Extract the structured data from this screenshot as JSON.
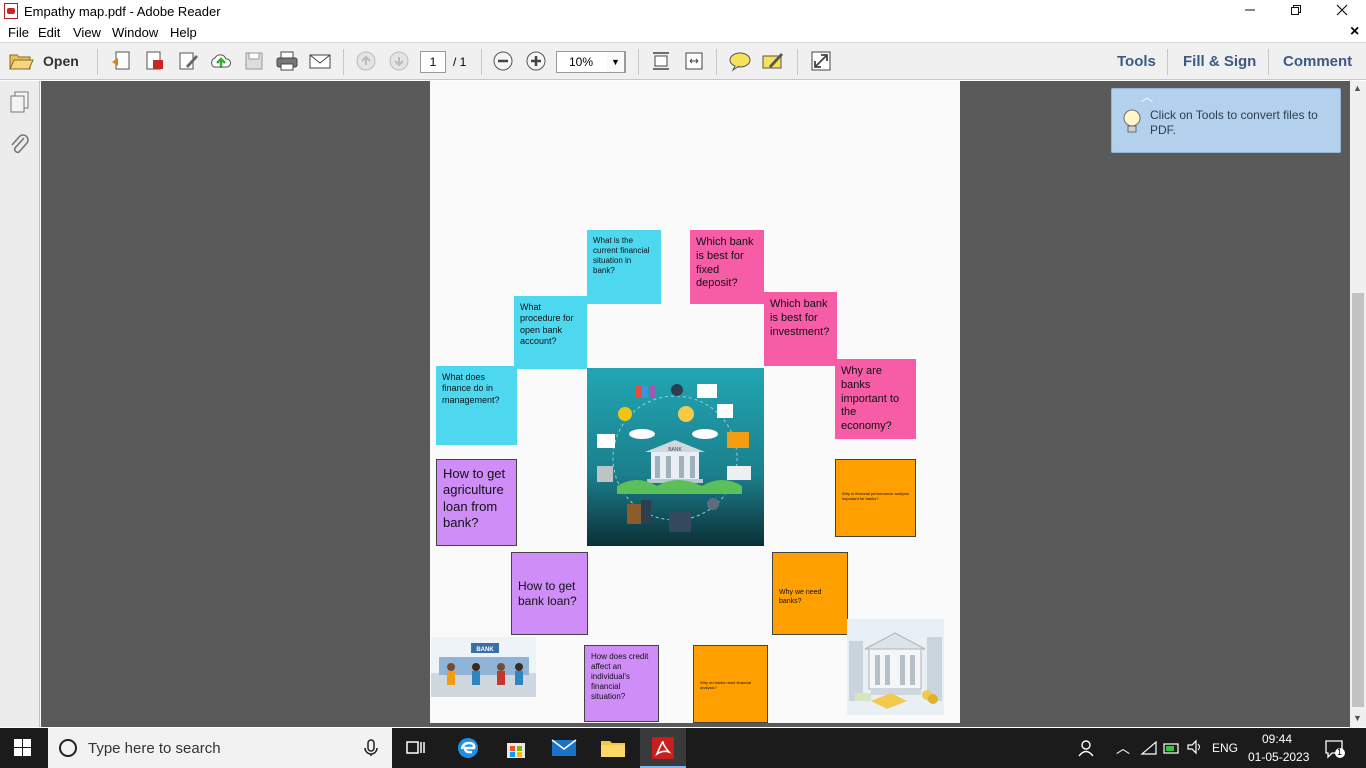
{
  "window": {
    "title": "Empathy map.pdf - Adobe Reader",
    "minimize_icon": "minimize-icon",
    "maximize_icon": "restore-icon",
    "close_icon": "close-icon"
  },
  "menu": {
    "items": [
      "File",
      "Edit",
      "View",
      "Window",
      "Help"
    ],
    "close_doc": "×"
  },
  "toolbar": {
    "open_label": "Open",
    "page_current": "1",
    "page_total": "/ 1",
    "zoom_value": "10%",
    "zoom_dropdown_icon": "chevron-down-icon",
    "tools_label": "Tools",
    "fill_sign_label": "Fill & Sign",
    "comment_label": "Comment"
  },
  "tooltip": {
    "text": "Click on Tools to convert files to PDF."
  },
  "document": {
    "notes": [
      {
        "id": "n1",
        "text": "What is the current financial situation in bank?",
        "color": "#4dd8f0"
      },
      {
        "id": "n2",
        "text": "Which bank is best for fixed deposit?",
        "color": "#f75ca6"
      },
      {
        "id": "n3",
        "text": "What procedure for open bank account?",
        "color": "#4dd8f0"
      },
      {
        "id": "n4",
        "text": "Which bank is best for investment?",
        "color": "#f75ca6"
      },
      {
        "id": "n5",
        "text": "What does finance do in management?",
        "color": "#4dd8f0"
      },
      {
        "id": "n6",
        "text": "Why are banks important to the economy?",
        "color": "#f75ca6"
      },
      {
        "id": "n7",
        "text": "How to get agriculture loan from bank?",
        "color": "#cf8df8"
      },
      {
        "id": "n8",
        "text": "Why is financial performance analysis important for banks?",
        "color": "#ffa000"
      },
      {
        "id": "n9",
        "text": "How to get bank loan?",
        "color": "#cf8df8"
      },
      {
        "id": "n10",
        "text": "Why we need banks?",
        "color": "#ffa000"
      },
      {
        "id": "n11",
        "text": "How does credit affect an individual's financial situation?",
        "color": "#cf8df8"
      },
      {
        "id": "n12",
        "text": "Why do banks need financial analysis?",
        "color": "#ffa000"
      }
    ],
    "center_image_label": "BANK",
    "left_image_label": "BANK"
  },
  "taskbar": {
    "search_placeholder": "Type here to search",
    "language": "ENG",
    "time": "09:44",
    "date": "01-05-2023",
    "notification_count": "1"
  }
}
